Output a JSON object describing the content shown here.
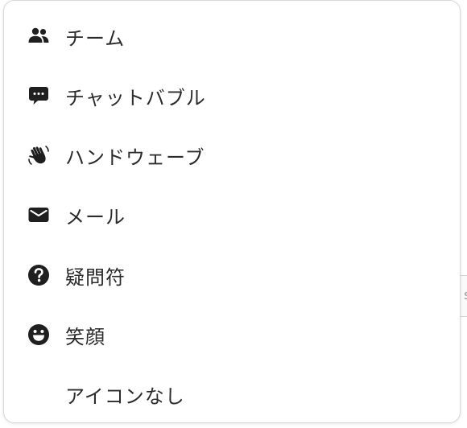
{
  "menu": {
    "items": [
      {
        "label": "チーム",
        "icon": "team-icon"
      },
      {
        "label": "チャットバブル",
        "icon": "chat-bubble-icon"
      },
      {
        "label": "ハンドウェーブ",
        "icon": "hand-wave-icon"
      },
      {
        "label": "メール",
        "icon": "mail-icon"
      },
      {
        "label": "疑問符",
        "icon": "question-mark-icon"
      },
      {
        "label": "笑顔",
        "icon": "smiley-icon"
      },
      {
        "label": "アイコンなし",
        "icon": "none"
      }
    ]
  },
  "colors": {
    "icon": "#1f1f1f",
    "text": "#2b2b2b",
    "border": "#d9d9d9",
    "background": "#ffffff"
  }
}
